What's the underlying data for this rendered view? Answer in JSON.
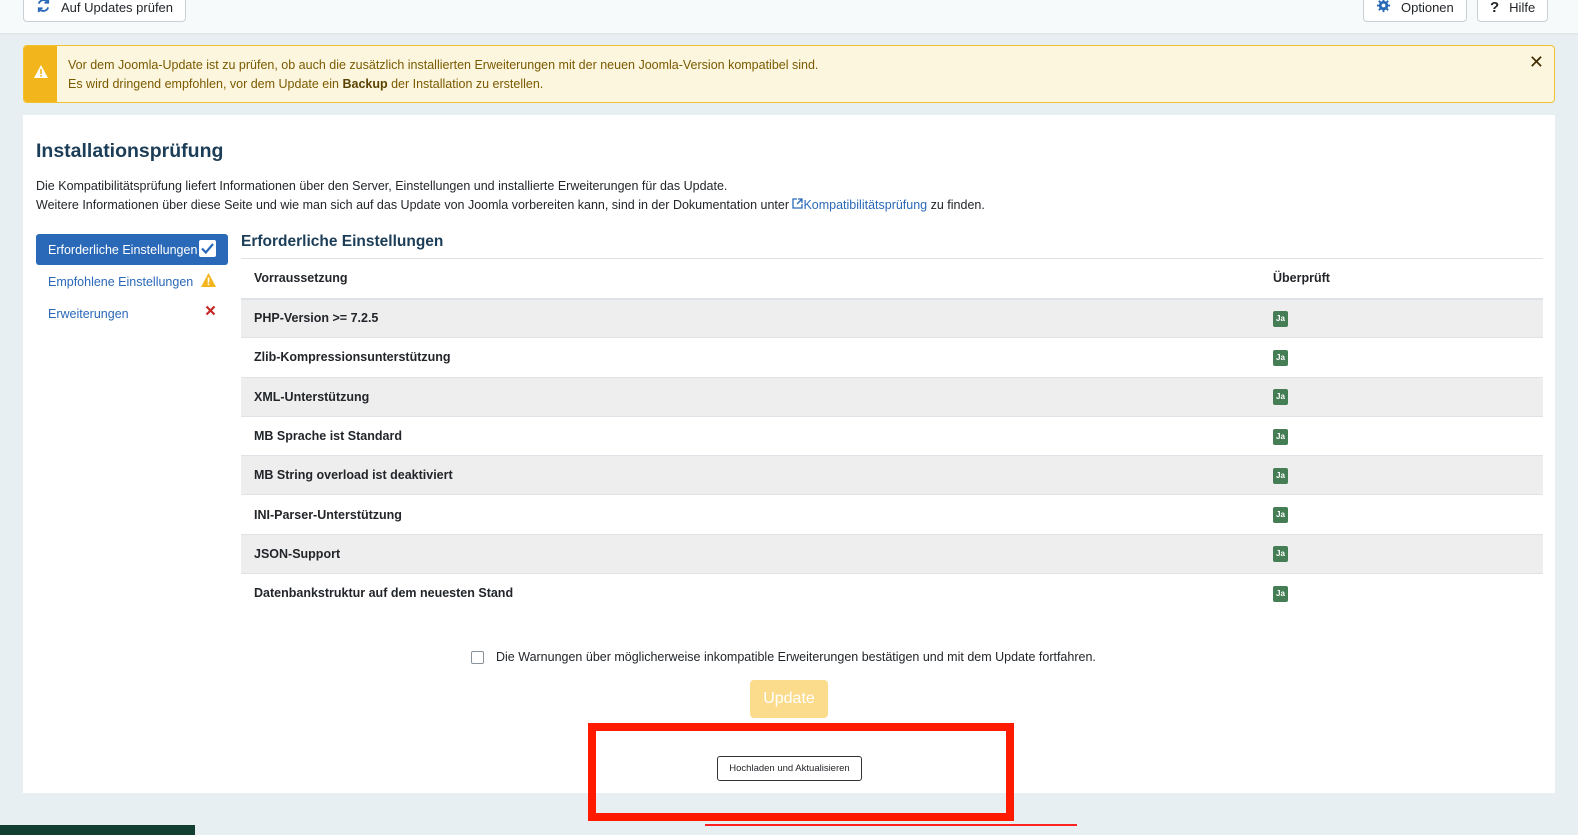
{
  "toolbar": {
    "check_updates": "Auf Updates prüfen",
    "options": "Optionen",
    "help": "Hilfe"
  },
  "alert": {
    "line1": "Vor dem Joomla-Update ist zu prüfen, ob auch die zusätzlich installierten Erweiterungen mit der neuen Joomla-Version kompatibel sind.",
    "line2_pre": "Es wird dringend empfohlen, vor dem Update ein ",
    "line2_bold": "Backup",
    "line2_post": " der Installation zu erstellen.",
    "close": "✕",
    "color": "#f3b51c"
  },
  "page": {
    "title": "Installationsprüfung",
    "desc1": "Die Kompatibilitätsprüfung liefert Informationen über den Server, Einstellungen und installierte Erweiterungen für das Update.",
    "desc2_pre": "Weitere Informationen über diese Seite und wie man sich auf das Update von Joomla vorbereiten kann, sind in der Dokumentation unter ",
    "desc2_link": "Kompatibilitätsprüfung",
    "desc2_post": " zu finden."
  },
  "sidebar": {
    "items": [
      {
        "label": "Erforderliche Einstellungen",
        "status": "check-icon"
      },
      {
        "label": "Empfohlene Einstellungen",
        "status": "warning-icon"
      },
      {
        "label": "Erweiterungen",
        "status": "cross-icon"
      }
    ]
  },
  "section": {
    "title": "Erforderliche Einstellungen",
    "col_requirement": "Vorraussetzung",
    "col_checked": "Überprüft",
    "rows": [
      {
        "name": "PHP-Version >= 7.2.5",
        "status": "Ja"
      },
      {
        "name": "Zlib-Kompressionsunterstützung",
        "status": "Ja"
      },
      {
        "name": "XML-Unterstützung",
        "status": "Ja"
      },
      {
        "name": "MB Sprache ist Standard",
        "status": "Ja"
      },
      {
        "name": "MB String overload ist deaktiviert",
        "status": "Ja"
      },
      {
        "name": "INI-Parser-Unterstützung",
        "status": "Ja"
      },
      {
        "name": "JSON-Support",
        "status": "Ja"
      },
      {
        "name": "Datenbankstruktur auf dem neuesten Stand",
        "status": "Ja"
      }
    ]
  },
  "confirm_label": "Die Warnungen über möglicherweise inkompatible Erweiterungen bestätigen und mit dem Update fortfahren.",
  "update_button": "Update",
  "upload_button": "Hochladen und Aktualisieren"
}
